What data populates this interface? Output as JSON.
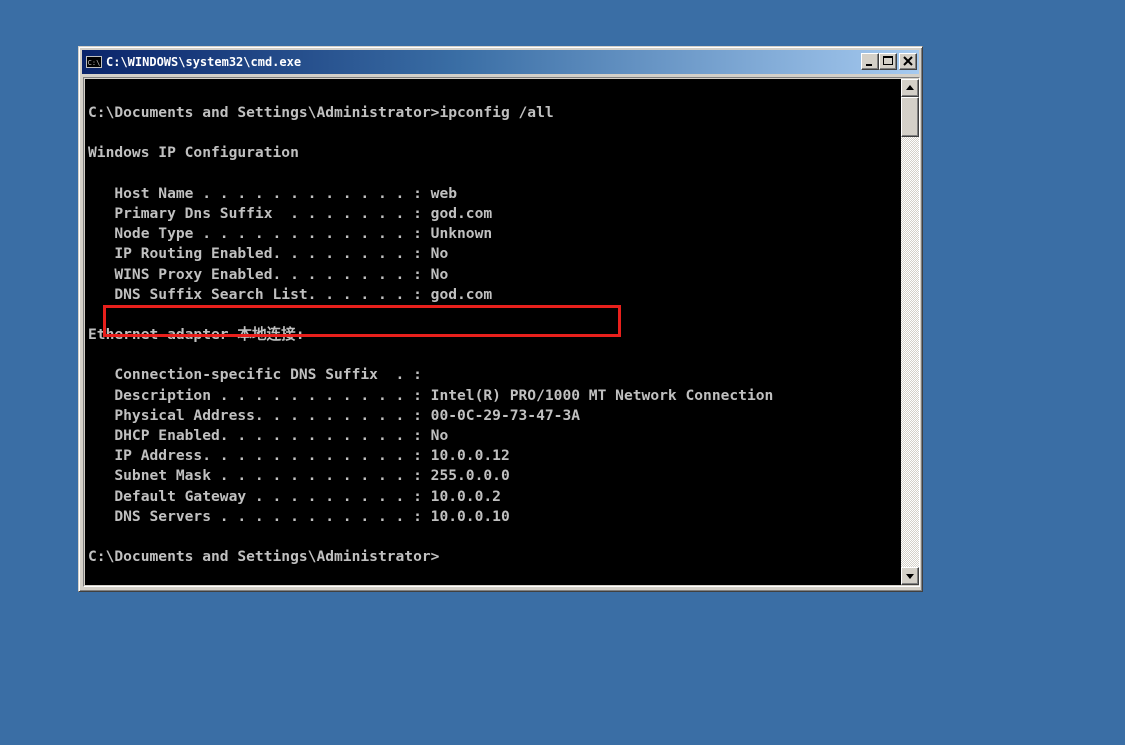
{
  "window": {
    "title": "C:\\WINDOWS\\system32\\cmd.exe",
    "icon": "cmd-icon",
    "icon_text": "C:\\"
  },
  "console": {
    "lines": [
      "C:\\Documents and Settings\\Administrator>ipconfig /all",
      "",
      "Windows IP Configuration",
      "",
      "   Host Name . . . . . . . . . . . . : web",
      "   Primary Dns Suffix  . . . . . . . : god.com",
      "   Node Type . . . . . . . . . . . . : Unknown",
      "   IP Routing Enabled. . . . . . . . : No",
      "   WINS Proxy Enabled. . . . . . . . : No",
      "   DNS Suffix Search List. . . . . . : god.com",
      "",
      "Ethernet adapter 本地连接:",
      "",
      "   Connection-specific DNS Suffix  . :",
      "   Description . . . . . . . . . . . : Intel(R) PRO/1000 MT Network Connection",
      "   Physical Address. . . . . . . . . : 00-0C-29-73-47-3A",
      "   DHCP Enabled. . . . . . . . . . . : No",
      "   IP Address. . . . . . . . . . . . : 10.0.0.12",
      "   Subnet Mask . . . . . . . . . . . : 255.0.0.0",
      "   Default Gateway . . . . . . . . . : 10.0.0.2",
      "   DNS Servers . . . . . . . . . . . : 10.0.0.10",
      "",
      "C:\\Documents and Settings\\Administrator>"
    ],
    "highlight_color": "#e8201c",
    "text_color": "#c0c0c0",
    "background": "#000000"
  },
  "titlebar_buttons": {
    "minimize": "minimize-icon",
    "maximize": "maximize-icon",
    "close": "close-icon"
  },
  "colors": {
    "desktop": "#3a6ea5",
    "titlebar_start": "#0a246a",
    "titlebar_end": "#a6caf0",
    "chrome": "#d4d0c8"
  }
}
